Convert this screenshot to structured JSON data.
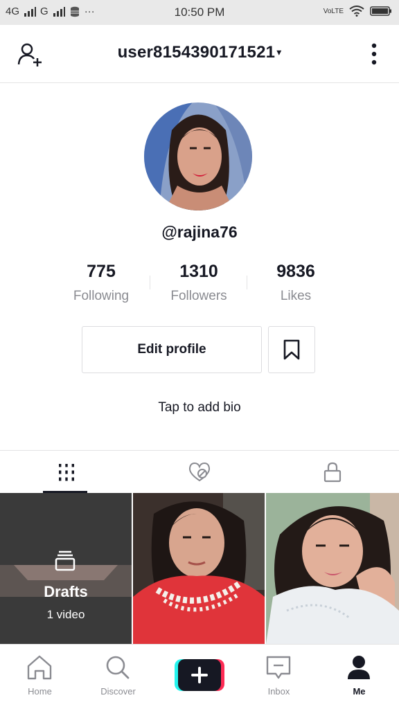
{
  "status_bar": {
    "network_left": "4G",
    "network_right": "G",
    "more": "···",
    "time": "10:50 PM",
    "volte": "VoLTE"
  },
  "header": {
    "username": "user8154390171521",
    "caret": "▾"
  },
  "profile": {
    "handle": "@rajina76",
    "stats": [
      {
        "value": "775",
        "label": "Following"
      },
      {
        "value": "1310",
        "label": "Followers"
      },
      {
        "value": "9836",
        "label": "Likes"
      }
    ],
    "edit_button": "Edit profile",
    "bio_prompt": "Tap to add bio"
  },
  "grid": {
    "drafts_title": "Drafts",
    "drafts_count": "1 video"
  },
  "nav": [
    {
      "label": "Home"
    },
    {
      "label": "Discover"
    },
    {
      "label": "Inbox"
    },
    {
      "label": "Me"
    }
  ],
  "colors": {
    "text_primary": "#161823",
    "text_secondary": "#8a8b91",
    "create_cyan": "#25f4ee",
    "create_red": "#fe2c55"
  }
}
